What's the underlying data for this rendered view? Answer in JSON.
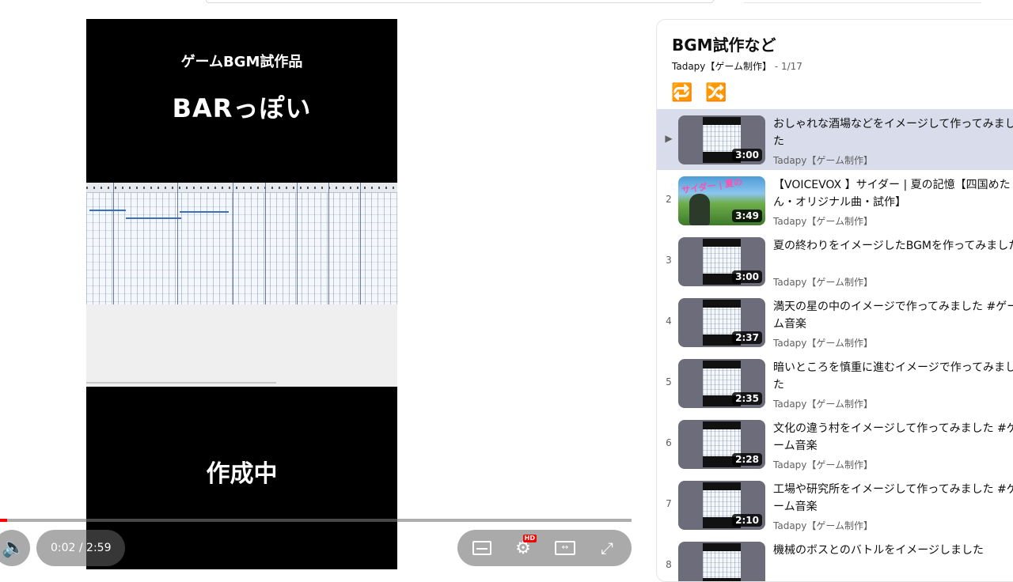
{
  "video": {
    "title_small": "ゲームBGM試作品",
    "title_big": "BARっぽい",
    "title_wip": "作成中"
  },
  "player": {
    "progress_fraction": 0.011,
    "time_display": "0:02 / 2:59",
    "hd_badge": "HD",
    "icons": [
      "volume-icon",
      "subtitles-icon",
      "settings-icon",
      "theater-icon",
      "fullscreen-icon"
    ]
  },
  "playlist": {
    "title": "BGM試作など",
    "channel": "Tadapy【ゲーム制作】",
    "position": " - 1/17",
    "icons": [
      "loop-icon",
      "shuffle-icon"
    ],
    "items": [
      {
        "index": "▶",
        "title": "おしゃれな酒場などをイメージして作ってみました",
        "channel": "Tadapy【ゲーム制作】",
        "duration": "3:00",
        "active": true
      },
      {
        "index": "2",
        "title": "【VOICEVOX 】サイダー | 夏の記憶【四国めたん・オリジナル曲・試作】",
        "channel": "Tadapy【ゲーム制作】",
        "duration": "3:49",
        "thumb_text": "サイダー | 夏の"
      },
      {
        "index": "3",
        "title": "夏の終わりをイメージしたBGMを作ってみました",
        "channel": "Tadapy【ゲーム制作】",
        "duration": "3:00"
      },
      {
        "index": "4",
        "title": "満天の星の中のイメージで作ってみました #ゲーム音楽",
        "channel": "Tadapy【ゲーム制作】",
        "duration": "2:37"
      },
      {
        "index": "5",
        "title": "暗いところを慎重に進むイメージで作ってみました",
        "channel": "Tadapy【ゲーム制作】",
        "duration": "2:35"
      },
      {
        "index": "6",
        "title": "文化の違う村をイメージして作ってみました #ゲーム音楽",
        "channel": "Tadapy【ゲーム制作】",
        "duration": "2:28"
      },
      {
        "index": "7",
        "title": "工場や研究所をイメージして作ってみました #ゲーム音楽",
        "channel": "Tadapy【ゲーム制作】",
        "duration": "2:10"
      },
      {
        "index": "8",
        "title": "機械のボスとのバトルをイメージしました",
        "channel": "Tadapy【ゲーム制作】",
        "duration": ""
      }
    ]
  }
}
